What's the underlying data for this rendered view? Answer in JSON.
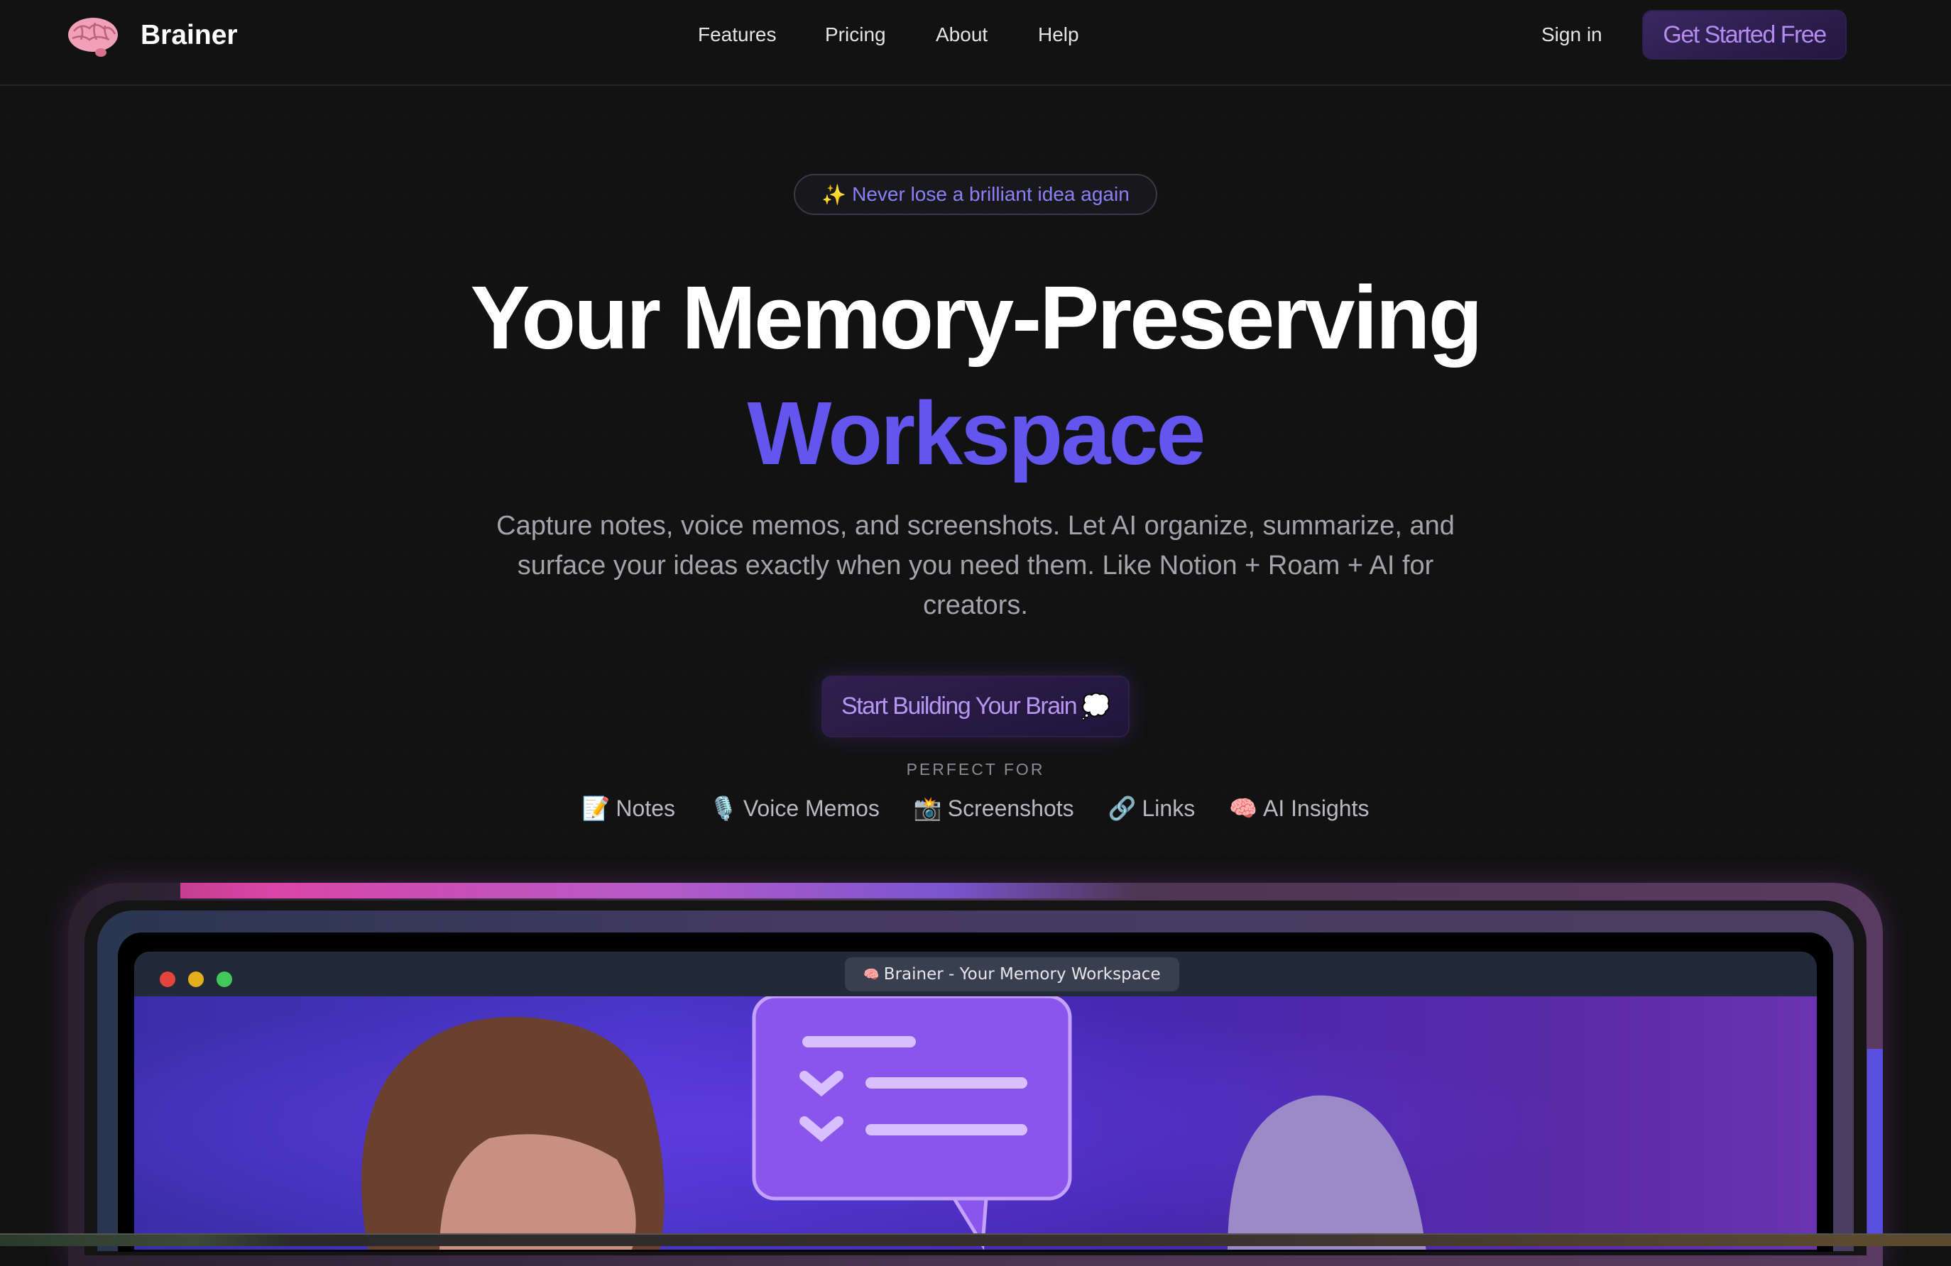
{
  "nav": {
    "brand": "Brainer",
    "links": [
      "Features",
      "Pricing",
      "About",
      "Help"
    ],
    "sign_in": "Sign in",
    "cta": "Get Started Free"
  },
  "hero": {
    "badge_icon": "✨",
    "badge": "Never lose a brilliant idea again",
    "title_line1": "Your Memory-Preserving",
    "title_line2": "Workspace",
    "description": "Capture notes, voice memos, and screenshots. Let AI organize, summarize, and surface your ideas exactly when you need them. Like Notion + Roam + AI for creators.",
    "cta": "Start Building Your Brain",
    "cta_icon": "💭",
    "perfect_for_label": "PERFECT FOR",
    "perfect_for": [
      {
        "icon": "📝",
        "label": "Notes"
      },
      {
        "icon": "🎙️",
        "label": "Voice Memos"
      },
      {
        "icon": "📸",
        "label": "Screenshots"
      },
      {
        "icon": "🔗",
        "label": "Links"
      },
      {
        "icon": "🧠",
        "label": "AI Insights"
      }
    ]
  },
  "preview": {
    "window_title": "Brainer - Your Memory Workspace",
    "window_icon": "🧠"
  },
  "colors": {
    "accent": "#6356ee",
    "background": "#121212",
    "badge_text": "#8b80f5",
    "cta_text": "#b896f2"
  }
}
